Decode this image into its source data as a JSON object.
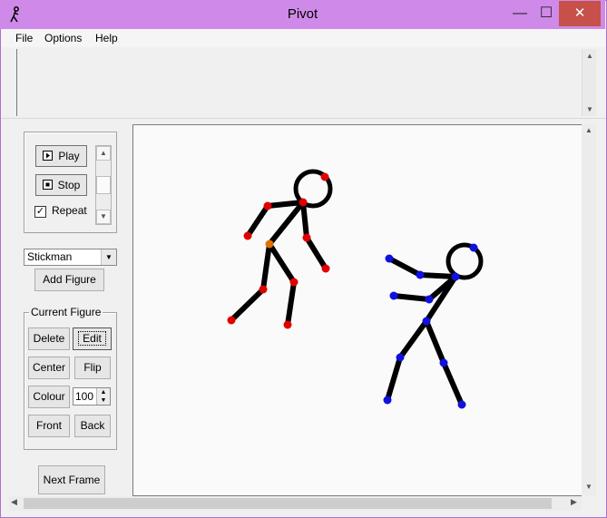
{
  "window": {
    "title": "Pivot",
    "minimize_glyph": "—",
    "maximize_glyph": "☐",
    "close_glyph": "✕",
    "titlebar_color": "#cf8ae9",
    "close_color": "#c7504a"
  },
  "menu": {
    "file": "File",
    "options": "Options",
    "help": "Help"
  },
  "playback": {
    "play_label": "Play",
    "stop_label": "Stop",
    "repeat_label": "Repeat",
    "repeat_checked": true,
    "check_glyph": "✓"
  },
  "figure_type": {
    "selected": "Stickman",
    "add_label": "Add Figure"
  },
  "current_figure": {
    "group_label": "Current Figure",
    "delete_label": "Delete",
    "edit_label": "Edit",
    "center_label": "Center",
    "flip_label": "Flip",
    "colour_label": "Colour",
    "size_value": "100",
    "front_label": "Front",
    "back_label": "Back"
  },
  "next_frame_label": "Next Frame",
  "colors": {
    "red_joint": "#e00000",
    "orange_joint": "#e07000",
    "blue_joint": "#1010e0",
    "limb": "#000000"
  }
}
